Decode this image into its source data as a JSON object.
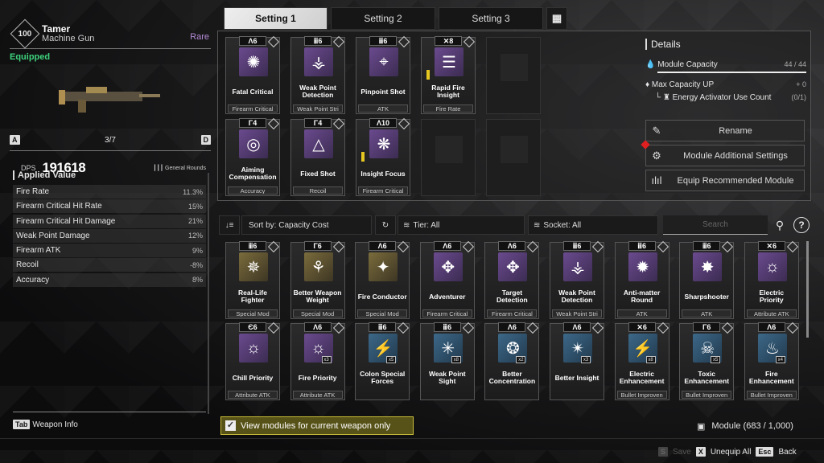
{
  "weapon": {
    "level": "100",
    "name": "Tamer",
    "type": "Machine Gun",
    "rarity": "Rare",
    "status": "Equipped",
    "page": "3/7",
    "prev_key": "A",
    "next_key": "D",
    "dps_label": "DPS",
    "dps": "191618",
    "ammo": "General Rounds"
  },
  "applied": {
    "title": "Applied Value",
    "stats": [
      {
        "name": "Fire Rate",
        "value": "11.3%"
      },
      {
        "name": "Firearm Critical Hit Rate",
        "value": "15%"
      },
      {
        "name": "Firearm Critical Hit Damage",
        "value": "21%"
      },
      {
        "name": "Weak Point Damage",
        "value": "12%"
      },
      {
        "name": "Firearm ATK",
        "value": "9%"
      },
      {
        "name": "Recoil",
        "value": "-8%"
      },
      {
        "name": "Accuracy",
        "value": "8%"
      }
    ]
  },
  "tab_info": {
    "key": "Tab",
    "label": "Weapon Info"
  },
  "tabs": [
    {
      "label": "Setting 1"
    },
    {
      "label": "Setting 2"
    },
    {
      "label": "Setting 3"
    }
  ],
  "add_tab_icon": "grid-plus-icon",
  "equipped": [
    {
      "cost": "Λ6",
      "name": "Fatal Critical",
      "cat": "Firearm Critical",
      "color": "purple",
      "glyph": "✺"
    },
    {
      "cost": "ⅲ6",
      "name": "Weak Point Detection",
      "cat": "Weak Point Stri",
      "color": "purple",
      "glyph": "⚶"
    },
    {
      "cost": "ⅲ6",
      "name": "Pinpoint Shot",
      "cat": "ATK",
      "color": "purple",
      "glyph": "⌖"
    },
    {
      "cost": "✕8",
      "name": "Rapid Fire Insight",
      "cat": "Fire Rate",
      "color": "purple",
      "glyph": "☰",
      "bar": true
    },
    {
      "cost": "Γ4",
      "name": "Aiming Compensation",
      "cat": "Accuracy",
      "color": "purple",
      "glyph": "◎"
    },
    {
      "cost": "Γ4",
      "name": "Fixed Shot",
      "cat": "Recoil",
      "color": "purple",
      "glyph": "△"
    },
    {
      "cost": "Λ10",
      "name": "Insight Focus",
      "cat": "Firearm Critical",
      "color": "purple",
      "glyph": "❋",
      "bar": true
    }
  ],
  "details": {
    "title": "Details",
    "capacity_label": "Module Capacity",
    "capacity": "44 / 44",
    "capacity_fraction": 1.0,
    "maxup_label": "Max Capacity UP",
    "maxup": "+ 0",
    "activator_label": "Energy Activator Use Count",
    "activator": "(0/1)"
  },
  "buttons": {
    "rename": "Rename",
    "additional": "Module Additional Settings",
    "recommend": "Equip Recommended Module"
  },
  "filters": {
    "sort": "Sort by: Capacity Cost",
    "tier": "Tier: All",
    "socket": "Socket: All",
    "search_placeholder": "Search"
  },
  "inventory": [
    {
      "cost": "ⅲ6",
      "name": "Real-Life Fighter",
      "cat": "Special Mod",
      "color": "gold",
      "glyph": "✵"
    },
    {
      "cost": "Γ6",
      "name": "Better Weapon Weight",
      "cat": "Special Mod",
      "color": "gold",
      "glyph": "⚘"
    },
    {
      "cost": "Λ6",
      "name": "Fire Conductor",
      "cat": "Special Mod",
      "color": "gold",
      "glyph": "✦"
    },
    {
      "cost": "Λ6",
      "name": "Adventurer",
      "cat": "Firearm Critical",
      "color": "purple",
      "glyph": "✥"
    },
    {
      "cost": "Λ6",
      "name": "Target Detection",
      "cat": "Firearm Critical",
      "color": "purple",
      "glyph": "✥"
    },
    {
      "cost": "ⅲ6",
      "name": "Weak Point Detection",
      "cat": "Weak Point Stri",
      "color": "purple",
      "glyph": "⚶"
    },
    {
      "cost": "ⅲ6",
      "name": "Anti-matter Round",
      "cat": "ATK",
      "color": "purple",
      "glyph": "✹"
    },
    {
      "cost": "ⅲ6",
      "name": "Sharpshooter",
      "cat": "ATK",
      "color": "purple",
      "glyph": "✸"
    },
    {
      "cost": "✕6",
      "name": "Electric Priority",
      "cat": "Attribute ATK",
      "color": "purple",
      "glyph": "☼"
    },
    {
      "cost": "Є6",
      "name": "Chill Priority",
      "cat": "Attribute ATK",
      "color": "purple",
      "glyph": "☼"
    },
    {
      "cost": "Λ6",
      "name": "Fire Priority",
      "cat": "Attribute ATK",
      "color": "purple",
      "glyph": "☼",
      "stack": "x3"
    },
    {
      "cost": "ⅲ6",
      "name": "Colon Special Forces",
      "cat": "",
      "color": "blue",
      "glyph": "⚡",
      "stack": "x5"
    },
    {
      "cost": "ⅲ6",
      "name": "Weak Point Sight",
      "cat": "",
      "color": "blue",
      "glyph": "✳",
      "stack": "x8"
    },
    {
      "cost": "Λ6",
      "name": "Better Concentration",
      "cat": "",
      "color": "blue",
      "glyph": "❂",
      "stack": "x2"
    },
    {
      "cost": "Λ6",
      "name": "Better Insight",
      "cat": "",
      "color": "blue",
      "glyph": "✴",
      "stack": "x3"
    },
    {
      "cost": "✕6",
      "name": "Electric Enhancement",
      "cat": "Bullet Improven",
      "color": "blue",
      "glyph": "⚡",
      "stack": "x8"
    },
    {
      "cost": "Γ6",
      "name": "Toxic Enhancement",
      "cat": "Bullet Improven",
      "color": "blue",
      "glyph": "☠",
      "stack": "x5"
    },
    {
      "cost": "Λ6",
      "name": "Fire Enhancement",
      "cat": "Bullet Improven",
      "color": "blue",
      "glyph": "♨",
      "stack": "x4"
    }
  ],
  "view_current_only": {
    "label": "View modules for current weapon only",
    "checked": true
  },
  "module_count": "Module (683 / 1,000)",
  "footer": {
    "save_key": "S",
    "save": "Save",
    "unequip_key": "X",
    "unequip": "Unequip All",
    "back_key": "Esc",
    "back": "Back"
  }
}
